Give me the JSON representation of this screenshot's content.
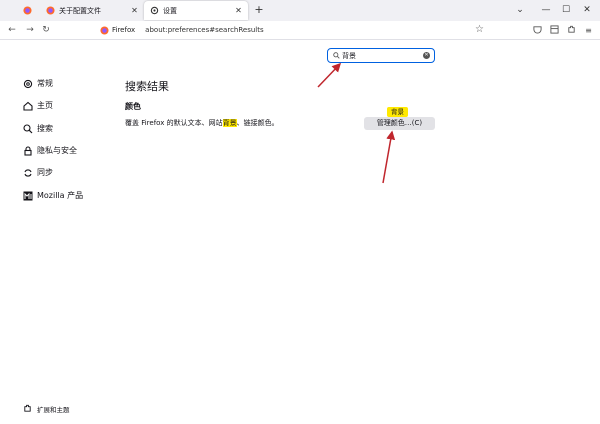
{
  "browser": {
    "tabs": [
      {
        "label": "关于配置文件",
        "icon": "firefox-icon"
      },
      {
        "label": "设置",
        "icon": "gear-icon"
      }
    ],
    "url_site": "Firefox",
    "url_path": "about:preferences#searchResults"
  },
  "search": {
    "value": "背景"
  },
  "sidebar": {
    "items": [
      {
        "label": "常规",
        "icon": "gear-icon"
      },
      {
        "label": "主页",
        "icon": "home-icon"
      },
      {
        "label": "搜索",
        "icon": "search-icon"
      },
      {
        "label": "隐私与安全",
        "icon": "lock-icon"
      },
      {
        "label": "同步",
        "icon": "sync-icon"
      },
      {
        "label": "Mozilla 产品",
        "icon": "mozilla-icon"
      }
    ],
    "extensions_label": "扩展和主题"
  },
  "results": {
    "heading": "搜索结果",
    "section_title": "颜色",
    "desc_before": "覆盖 Firefox 的默认文本、网站",
    "desc_highlight": "背景",
    "desc_after": "、链接颜色。",
    "tooltip": "背景",
    "button_label": "管理颜色…(C)"
  },
  "colors": {
    "accent": "#0061e0",
    "highlight": "#ffe900",
    "annotation_arrow": "#c0262d"
  }
}
